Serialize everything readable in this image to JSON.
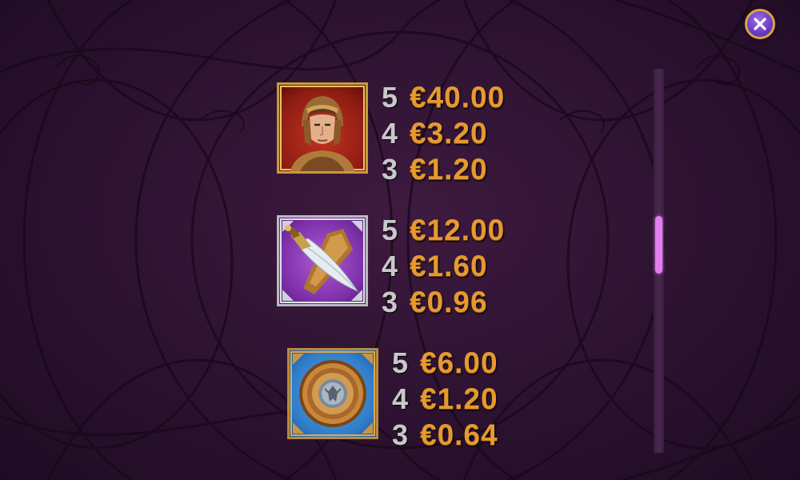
{
  "close_button": {
    "icon": "close-icon"
  },
  "paytable": [
    {
      "symbol": "warrior-helmet-icon",
      "lines": [
        {
          "count": "5",
          "amount": "€40.00"
        },
        {
          "count": "4",
          "amount": "€3.20"
        },
        {
          "count": "3",
          "amount": "€1.20"
        }
      ]
    },
    {
      "symbol": "sword-icon",
      "lines": [
        {
          "count": "5",
          "amount": "€12.00"
        },
        {
          "count": "4",
          "amount": "€1.60"
        },
        {
          "count": "3",
          "amount": "€0.96"
        }
      ]
    },
    {
      "symbol": "shield-icon",
      "lines": [
        {
          "count": "5",
          "amount": "€6.00"
        },
        {
          "count": "4",
          "amount": "€1.20"
        },
        {
          "count": "3",
          "amount": "€0.64"
        }
      ]
    }
  ],
  "scrollbar": {
    "position": 0.45
  },
  "colors": {
    "amount": "#e59a2f",
    "count": "#c8c8c8",
    "scroll_thumb": "#e27df0",
    "close_bg": "#6a3cc4"
  }
}
